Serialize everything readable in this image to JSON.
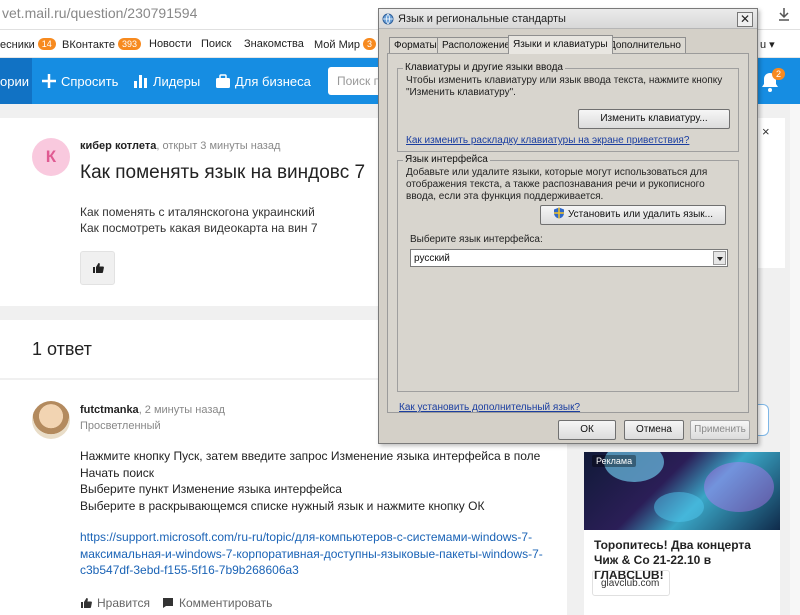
{
  "browser": {
    "address_domain": "vet.mail.ru",
    "address_path": "/question/230791594"
  },
  "linkbar": {
    "items": [
      {
        "label": "есники",
        "badge": "14"
      },
      {
        "label": "ВКонтакте",
        "badge": "393"
      },
      {
        "label": "Новости"
      },
      {
        "label": "Поиск"
      },
      {
        "label": "Знакомства"
      },
      {
        "label": "Мой Мир",
        "badge": "3"
      }
    ],
    "right_partial": "u"
  },
  "header": {
    "categories_partial": "ории",
    "ask_label": "Спросить",
    "leaders_label": "Лидеры",
    "business_label": "Для бизнеса",
    "search_placeholder": "Поиск по",
    "notifications_count": "2"
  },
  "question": {
    "avatar_letter": "К",
    "author": "кибер котлета",
    "meta": ", открыт 3 минуты назад",
    "title": "Как поменять язык на виндовс 7",
    "body_line1": "Как поменять с италянскогона украинский",
    "body_line2": "Как посмотреть какая видеокарта на вин 7"
  },
  "answers": {
    "count_label": "1 ответ",
    "items": [
      {
        "author": "futctmanka",
        "meta": ", 2 минуты назад",
        "rank": "Просветленный",
        "lines": [
          "Нажмите кнопку Пуск, затем введите запрос Изменение языка интерфейса в поле",
          "Начать поиск",
          "Выберите пункт Изменение языка интерфейса",
          "Выберите в раскрывающемся списке нужный язык и нажмите кнопку ОК"
        ],
        "link": "https://support.microsoft.com/ru-ru/topic/для-компьютеров-с-системами-windows-7-максимальная-и-windows-7-корпоративная-доступны-языковые-пакеты-windows-7-c3b547df-3ebd-f155-5f16-7b9b268606a3",
        "like_label": "Нравится",
        "comment_label": "Комментировать"
      }
    ]
  },
  "sidebar": {
    "close_glyph": "×",
    "ad": {
      "tag": "Реклама",
      "title": "Торопитесь! Два концерта Чиж & Co 21-22.10 в ГЛАВCLUB!",
      "button": "glavclub.com"
    }
  },
  "dialog": {
    "title": "Язык и региональные стандарты",
    "close_glyph": "✕",
    "tabs": [
      "Форматы",
      "Расположение",
      "Языки и клавиатуры",
      "Дополнительно"
    ],
    "active_tab": 2,
    "keyboards_group": {
      "label": "Клавиатуры и другие языки ввода",
      "text_line1": "Чтобы изменить клавиатуру или язык ввода текста, нажмите кнопку",
      "text_line2": "\"Изменить клавиатуру\".",
      "button": "Изменить клавиатуру...",
      "link": "Как изменить раскладку клавиатуры на экране приветствия?"
    },
    "interface_group": {
      "label": "Язык интерфейса",
      "text_line1": "Добавьте или удалите языки, которые могут использоваться для",
      "text_line2": "отображения текста, а также распознавания речи и рукописного",
      "text_line3": "ввода, если эта функция поддерживается.",
      "button": "Установить или удалить язык...",
      "select_label": "Выберите язык интерфейса:",
      "select_value": "русский"
    },
    "bottom_link": "Как установить дополнительный язык?",
    "ok": "ОК",
    "cancel": "Отмена",
    "apply": "Применить"
  }
}
